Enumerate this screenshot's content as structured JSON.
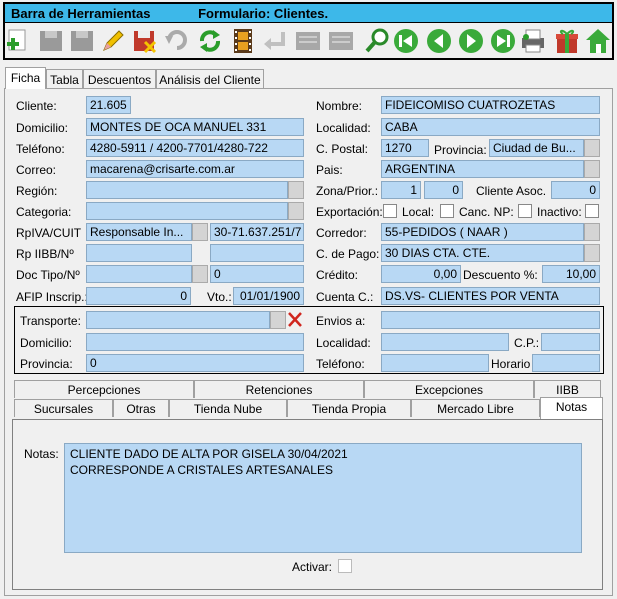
{
  "toolbar": {
    "title": "Barra de Herramientas",
    "form_title": "Formulario: Clientes.",
    "buttons": [
      "add-icon",
      "save-disabled-icon",
      "save-all-disabled-icon",
      "edit-icon",
      "save-delete-icon",
      "undo-disabled-icon",
      "refresh-icon",
      "film-icon",
      "return-disabled-icon",
      "list-disabled-icon",
      "list2-disabled-icon",
      "search-icon",
      "first-icon",
      "prev-icon",
      "next-icon",
      "last-icon",
      "print-icon",
      "gift-icon",
      "home-icon"
    ]
  },
  "tabs": [
    "Ficha",
    "Tabla",
    "Descuentos",
    "Análisis del Cliente"
  ],
  "labels": {
    "cliente": "Cliente:",
    "domicilio": "Domicilio:",
    "telefono": "Teléfono:",
    "correo": "Correo:",
    "region": "Región:",
    "categoria": "Categoria:",
    "rpiva": "RpIVA/CUIT",
    "rpiibb": "Rp IIBB/Nº",
    "doctipo": "Doc Tipo/Nº",
    "afip": "AFIP Inscrip.:",
    "vto": "Vto.:",
    "nombre": "Nombre:",
    "localidad": "Localidad:",
    "cpostal": "C. Postal:",
    "provincia": "Provincia:",
    "pais": "Pais:",
    "zona": "Zona/Prior.:",
    "cliente_asoc": "Cliente Asoc.",
    "exportacion": "Exportación:",
    "local": "Local:",
    "canc_np": "Canc. NP:",
    "inactivo": "Inactivo:",
    "corredor": "Corredor:",
    "cpago": "C. de Pago:",
    "credito": "Crédito:",
    "descuento": "Descuento %:",
    "cuenta": "Cuenta C.:",
    "transporte": "Transporte:",
    "envios": "Envios a:",
    "t_domicilio": "Domicilio:",
    "t_localidad": "Localidad:",
    "t_cp": "C.P.:",
    "t_provincia": "Provincia:",
    "t_telefono": "Teléfono:",
    "t_horario": "Horario",
    "notas": "Notas:",
    "activar": "Activar:"
  },
  "values": {
    "cliente": "21.605",
    "domicilio": "MONTES DE OCA MANUEL 331",
    "telefono": "4280-5911 / 4200-7701/4280-722",
    "correo": "macarena@crisarte.com.ar",
    "region": "",
    "categoria": "",
    "rpiva": "Responsable In...",
    "cuit": "30-71.637.251/7",
    "rpiibb": "",
    "rpiibb2": "",
    "doctipo": "",
    "docnum": "0",
    "afip": "0",
    "vto": "01/01/1900",
    "nombre": "FIDEICOMISO CUATROZETAS",
    "localidad": "CABA",
    "cpostal": "1270",
    "provincia": "Ciudad de Bu...",
    "pais": "ARGENTINA",
    "zona": "1",
    "prior": "0",
    "cliente_asoc": "0",
    "corredor": "55-PEDIDOS ( NAAR )",
    "cpago": "30 DIAS CTA. CTE.",
    "credito": "0,00",
    "descuento": "10,00",
    "cuenta": "DS.VS- CLIENTES POR VENTA",
    "transporte": "",
    "envios": "",
    "t_domicilio": "",
    "t_localidad": "",
    "t_cp": "",
    "t_provincia": "0",
    "t_telefono": "",
    "t_horario": ""
  },
  "subtabs_row1": [
    "Percepciones",
    "Retenciones",
    "Excepciones",
    "IIBB"
  ],
  "subtabs_row2": [
    "Sucursales",
    "Otras",
    "Tienda Nube",
    "Tienda Propia",
    "Mercado Libre",
    "Notas"
  ],
  "notes": {
    "line1": "CLIENTE DADO DE ALTA POR GISELA 30/04/2021",
    "line2": "CORRESPONDE A CRISTALES ARTESANALES"
  },
  "colors": {
    "field": "#b8d8f4",
    "title_bar": "#3db8e9"
  }
}
